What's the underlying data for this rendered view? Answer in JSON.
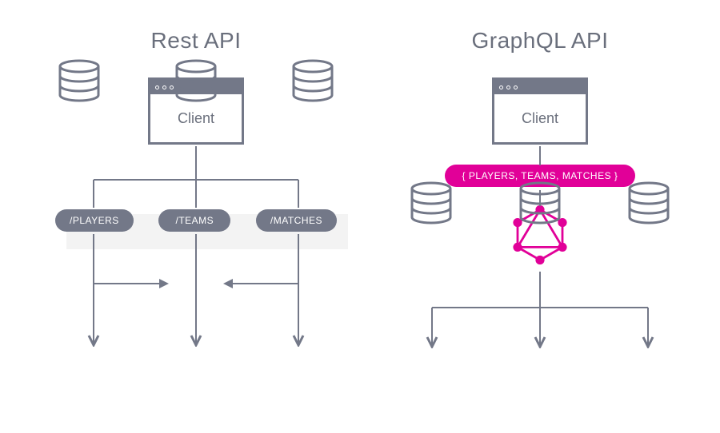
{
  "left": {
    "title": "Rest API",
    "client_label": "Client",
    "endpoints": [
      "/PLAYERS",
      "/TEAMS",
      "/MATCHES"
    ]
  },
  "right": {
    "title": "GraphQL API",
    "client_label": "Client",
    "query": "{ PLAYERS, TEAMS, MATCHES }"
  },
  "colors": {
    "slate": "#737888",
    "text": "#6A6F7C",
    "pink": "#E10098",
    "shadow": "#F3F3F3"
  }
}
